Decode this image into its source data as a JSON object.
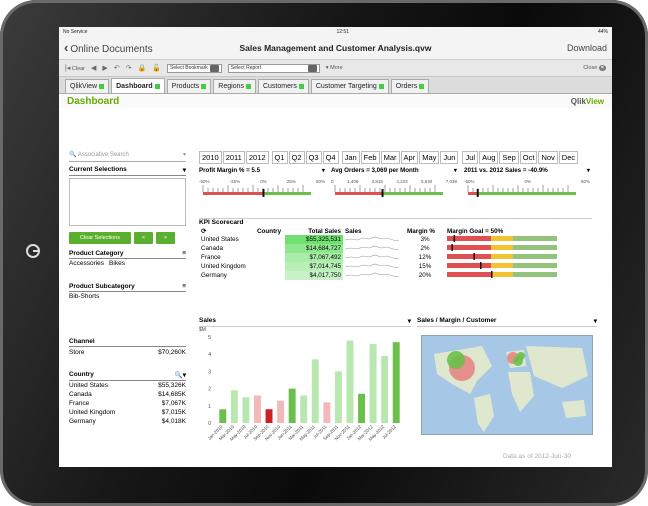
{
  "status": {
    "carrier": "No Service",
    "time": "12:51",
    "battery": "44%"
  },
  "nav": {
    "back": "Online Documents",
    "title": "Sales Management and Customer Analysis.qvw",
    "download": "Download"
  },
  "toolbar": {
    "clear": "Clear",
    "bookmark": "Select Bookmark",
    "report": "Select Report",
    "more": "More",
    "close": "Close"
  },
  "tabs": [
    "QlikView",
    "Dashboard",
    "Products",
    "Regions",
    "Customers",
    "Customer Targeting",
    "Orders"
  ],
  "dashboard": {
    "title": "Dashboard",
    "logo_a": "Qlik",
    "logo_b": "View"
  },
  "left": {
    "search": "Associative Search",
    "current": "Current Selections",
    "clear_btn": "Clear Selections",
    "back_btn": "<",
    "fwd_btn": ">",
    "product_category": "Product Category",
    "cat_items": [
      "Accessories",
      "Bikes"
    ],
    "product_subcategory": "Product Subcategory",
    "subcat": "Bib-Shorts",
    "channel": "Channel",
    "channel_item": "Store",
    "channel_val": "$70,260K",
    "country": "Country",
    "countries": [
      {
        "n": "United States",
        "v": "$55,326K"
      },
      {
        "n": "Canada",
        "v": "$14,685K"
      },
      {
        "n": "France",
        "v": "$7,067K"
      },
      {
        "n": "United Kingdom",
        "v": "$7,015K"
      },
      {
        "n": "Germany",
        "v": "$4,018K"
      }
    ]
  },
  "years": [
    "2010",
    "2011",
    "2012"
  ],
  "quarters": [
    "Q1",
    "Q2",
    "Q3",
    "Q4"
  ],
  "months": [
    "Jan",
    "Feb",
    "Mar",
    "Apr",
    "May",
    "Jun",
    "Jul",
    "Aug",
    "Sep",
    "Oct",
    "Nov",
    "Dec"
  ],
  "gauges": [
    {
      "title": "Profit Margin % = 5.5",
      "ticks": [
        "-50%",
        "-25%",
        "0%",
        "25%",
        "50%"
      ],
      "pointer": 0.56
    },
    {
      "title": "Avg Orders = 3,069 per Month",
      "ticks": [
        "0",
        "1,408",
        "2,815",
        "4,223",
        "5,630",
        "7,038"
      ],
      "pointer": 0.44
    },
    {
      "title": "2011 vs. 2012 Sales = -40.9%",
      "ticks": [
        "-50%",
        "0%",
        "50%"
      ],
      "pointer": 0.09
    }
  ],
  "kpi": {
    "title": "KPI Scorecard",
    "headers": [
      "Country",
      "Total Sales",
      "Sales",
      "Margin %",
      "Margin Goal = 50%"
    ],
    "rows": [
      {
        "c": "United States",
        "s": "$55,325,531",
        "m": "3%",
        "p": 0.06
      },
      {
        "c": "Canada",
        "s": "$14,684,727",
        "m": "2%",
        "p": 0.04
      },
      {
        "c": "France",
        "s": "$7,067,492",
        "m": "12%",
        "p": 0.24
      },
      {
        "c": "United Kingdom",
        "s": "$7,014,745",
        "m": "15%",
        "p": 0.3
      },
      {
        "c": "Germany",
        "s": "$4,017,750",
        "m": "20%",
        "p": 0.4
      }
    ]
  },
  "sales_panel": {
    "title": "Sales",
    "unit": "$M",
    "ymax": 5
  },
  "map_panel": {
    "title": "Sales / Margin / Customer"
  },
  "footer": "Data as of 2012-Jun-30",
  "colors": {
    "accent": "#5ab02e",
    "bad": "#d9534f"
  },
  "chart_data": {
    "type": "bar",
    "title": "Sales",
    "ylabel": "$M",
    "ylim": [
      0,
      5
    ],
    "categories": [
      "Jan-2010",
      "Mar-2010",
      "May-2010",
      "Jul-2010",
      "Sep-2010",
      "Nov-2010",
      "Jan-2011",
      "Mar-2011",
      "May-2011",
      "Jul-2011",
      "Sep-2011",
      "Nov-2011",
      "Jan-2012",
      "Mar-2012",
      "May-2012",
      "Jul-2012"
    ],
    "values": [
      0.8,
      1.9,
      1.5,
      1.6,
      0.8,
      1.3,
      2.0,
      1.6,
      3.7,
      1.2,
      3.0,
      4.8,
      1.7,
      4.6,
      3.9,
      4.7
    ]
  }
}
